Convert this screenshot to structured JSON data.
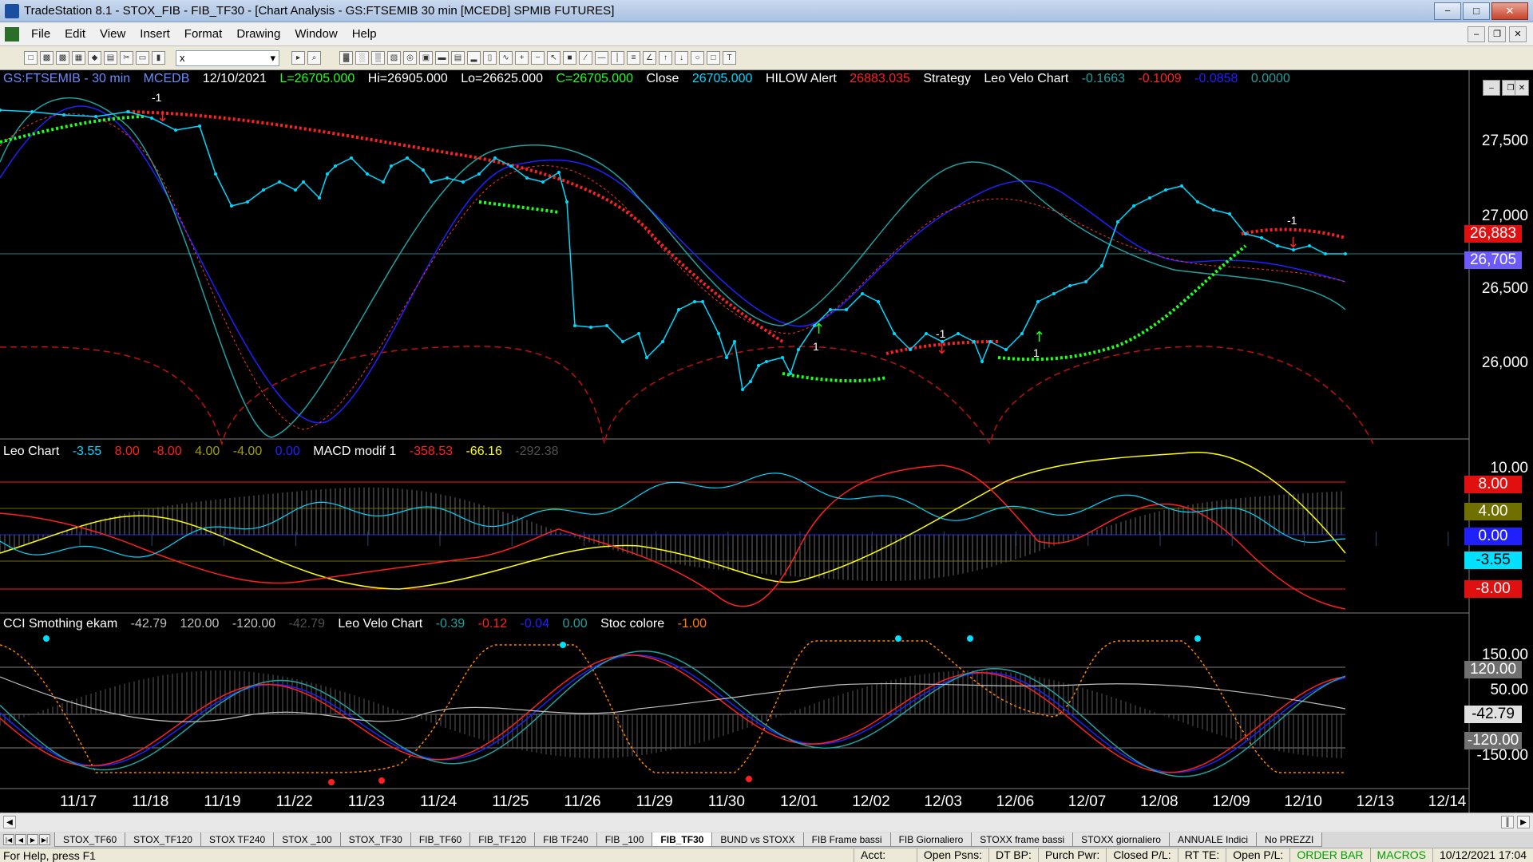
{
  "window": {
    "title": "TradeStation 8.1 - STOX_FIB - FIB_TF30 - [Chart Analysis - GS:FTSEMIB  30 min  [MCEDB] SPMIB FUTURES]",
    "minimize": "−",
    "maximize": "□",
    "close": "✕"
  },
  "menu": {
    "items": [
      "File",
      "Edit",
      "View",
      "Insert",
      "Format",
      "Drawing",
      "Window",
      "Help"
    ]
  },
  "toolbar": {
    "symbol_value": "x"
  },
  "chart": {
    "header": {
      "symbol": "GS:FTSEMIB - 30 min",
      "source": "MCEDB",
      "date": "12/10/2021",
      "last": "L=26705.000",
      "high": "Hi=26905.000",
      "low": "Lo=26625.000",
      "close": "C=26705.000",
      "close_label": "Close",
      "close_value": "26705.000",
      "alert_label": "HILOW Alert",
      "alert_value": "26883.035",
      "strategy": "Strategy",
      "velo_label": "Leo Velo Chart",
      "velo_v1": "-0.1663",
      "velo_v2": "-0.1009",
      "velo_v3": "-0.0858",
      "velo_v4": "0.0000"
    },
    "sub1_header": {
      "label": "Leo Chart",
      "v1": "-3.55",
      "v2": "8.00",
      "v3": "-8.00",
      "v4": "4.00",
      "v5": "-4.00",
      "v6": "0.00",
      "macd_label": "MACD modif 1",
      "m1": "-358.53",
      "m2": "-66.16",
      "m3": "-292.38"
    },
    "sub2_header": {
      "label": "CCI Smothing ekam",
      "v1": "-42.79",
      "v2": "120.00",
      "v3": "-120.00",
      "v4": "-42.79",
      "velo_label": "Leo Velo Chart",
      "w1": "-0.39",
      "w2": "-0.12",
      "w3": "-0.04",
      "w4": "0.00",
      "stoc_label": "Stoc colore",
      "s1": "-1.00"
    },
    "price_axis": [
      "27,500",
      "27,000",
      "26,500",
      "26,000"
    ],
    "price_labels": {
      "hilow": "26,883",
      "last": "26,705"
    },
    "sub1_axis": {
      "top": "10.00",
      "p8": "8.00",
      "p4": "4.00",
      "z": "0.00",
      "cur": "-3.55",
      "m8": "-8.00"
    },
    "sub2_axis": {
      "top": "150.00",
      "p120": "120.00",
      "p50": "50.00",
      "cur": "-42.79",
      "m120": "-120.00",
      "m150": "-150.00"
    },
    "marker_labels": {
      "m1": "-1",
      "m2": "1",
      "m3": "-1",
      "m4": "1",
      "m5": "-1"
    },
    "dates": [
      "11/17",
      "11/18",
      "11/19",
      "11/22",
      "11/23",
      "11/24",
      "11/25",
      "11/26",
      "11/29",
      "11/30",
      "12/01",
      "12/02",
      "12/03",
      "12/06",
      "12/07",
      "12/08",
      "12/09",
      "12/10",
      "12/13",
      "12/14"
    ],
    "colors": {
      "price": "#00d8ff",
      "hilow_red": "#ff2020",
      "hilow_green": "#20ff20",
      "blue_ma": "#2020ff",
      "teal_ma": "#20a0a0",
      "yellow": "#ffff00",
      "last_bg": "#6a5aff",
      "hilow_bg": "#e01010"
    }
  },
  "tabs": [
    "STOX_TF60",
    "STOX_TF120",
    "STOX TF240",
    "STOX _100",
    "STOX_TF30",
    "FIB_TF60",
    "FIB_TF120",
    "FIB TF240",
    "FIB _100",
    "FIB_TF30",
    "BUND vs STOXX",
    "FIB Frame bassi",
    "FIB Giornaliero",
    "STOXX frame bassi",
    "STOXX giornaliero",
    "ANNUALE Indici",
    "No PREZZI"
  ],
  "active_tab": "FIB_TF30",
  "status": {
    "help": "For Help, press F1",
    "acct": "Acct:",
    "open_psns": "Open Psns:",
    "dt_bp": "DT BP:",
    "purch_pwr": "Purch Pwr:",
    "closed_pl": "Closed P/L:",
    "rt_te": "RT TE:",
    "open_pl": "Open P/L:",
    "order_bar": "ORDER BAR",
    "macros": "MACROS",
    "datetime": "10/12/2021 17:04"
  }
}
